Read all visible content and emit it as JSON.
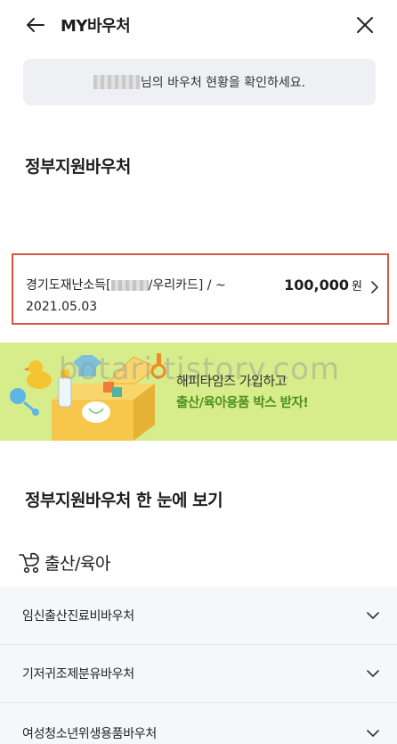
{
  "header": {
    "title": "MY바우처"
  },
  "notice": {
    "text": "님의 바우처 현황을 확인하세요."
  },
  "gov_voucher": {
    "title": "정부지원바우처"
  },
  "voucher_card": {
    "name_prefix": "경기도재난소득[",
    "name_suffix": "/우리카드] / ~",
    "date": "2021.05.03",
    "amount": "100,000",
    "currency": "원"
  },
  "banner": {
    "line1": "해피타임즈 가입하고",
    "line2": "출산/육아용품 박스 받자!",
    "watermark": "botari.tistory.com"
  },
  "overview": {
    "title": "정부지원바우처 한 눈에 보기"
  },
  "category": {
    "label": "출산/육아",
    "icon": "stroller-icon"
  },
  "list": [
    {
      "label": "임신출산진료비바우처"
    },
    {
      "label": "기저귀조제분유바우처"
    },
    {
      "label": "여성청소년위생용품바우처"
    }
  ]
}
